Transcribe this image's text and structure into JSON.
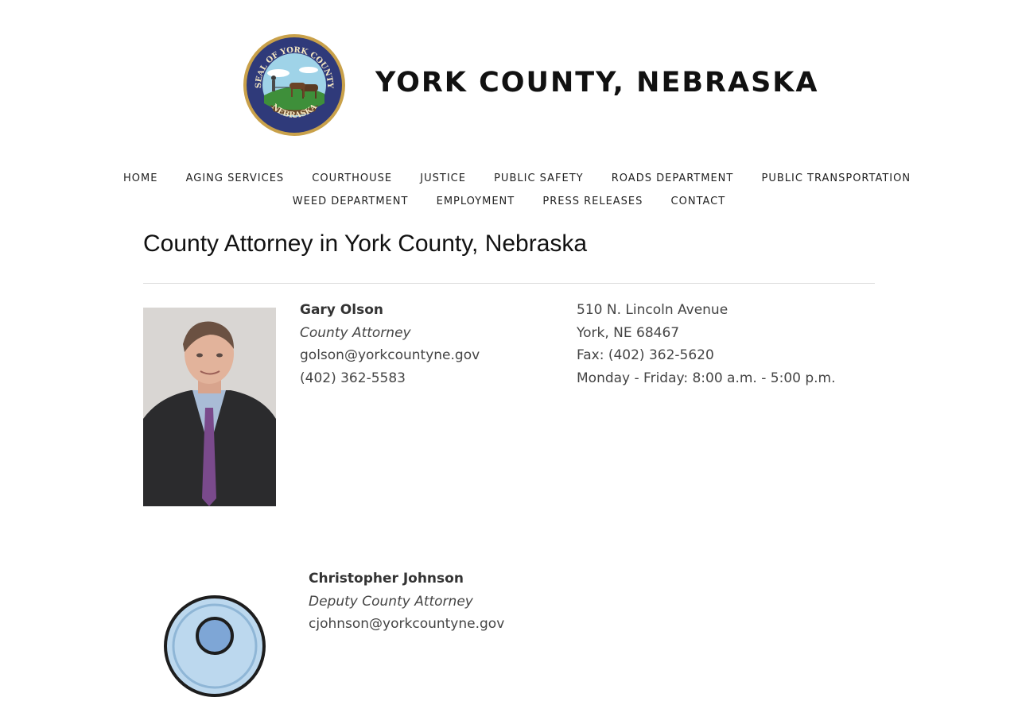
{
  "site": {
    "title": "YORK COUNTY, NEBRASKA",
    "seal_text_top": "SEAL OF YORK COUNTY",
    "seal_text_bottom": "NEBRASKA"
  },
  "nav": {
    "row1": [
      "HOME",
      "AGING SERVICES",
      "COURTHOUSE",
      "JUSTICE",
      "PUBLIC SAFETY",
      "ROADS DEPARTMENT",
      "PUBLIC TRANSPORTATION"
    ],
    "row2": [
      "WEED DEPARTMENT",
      "EMPLOYMENT",
      "PRESS RELEASES",
      "CONTACT"
    ]
  },
  "page": {
    "title": "County Attorney in York County, Nebraska"
  },
  "contacts": [
    {
      "name": "Gary Olson",
      "role": "County Attorney",
      "email": "golson@yorkcountyne.gov",
      "phone": "(402) 362-5583"
    },
    {
      "name": "Christopher Johnson",
      "role": "Deputy County Attorney",
      "email": "cjohnson@yorkcountyne.gov"
    }
  ],
  "office": {
    "street": "510 N. Lincoln Avenue",
    "city": "York, NE 68467",
    "fax": "Fax: (402) 362-5620",
    "hours": "Monday - Friday: 8:00 a.m. - 5:00 p.m."
  },
  "colors": {
    "seal_blue": "#2f3a7a",
    "seal_gold": "#c9a14a",
    "tie_purple": "#7a4a8c"
  }
}
